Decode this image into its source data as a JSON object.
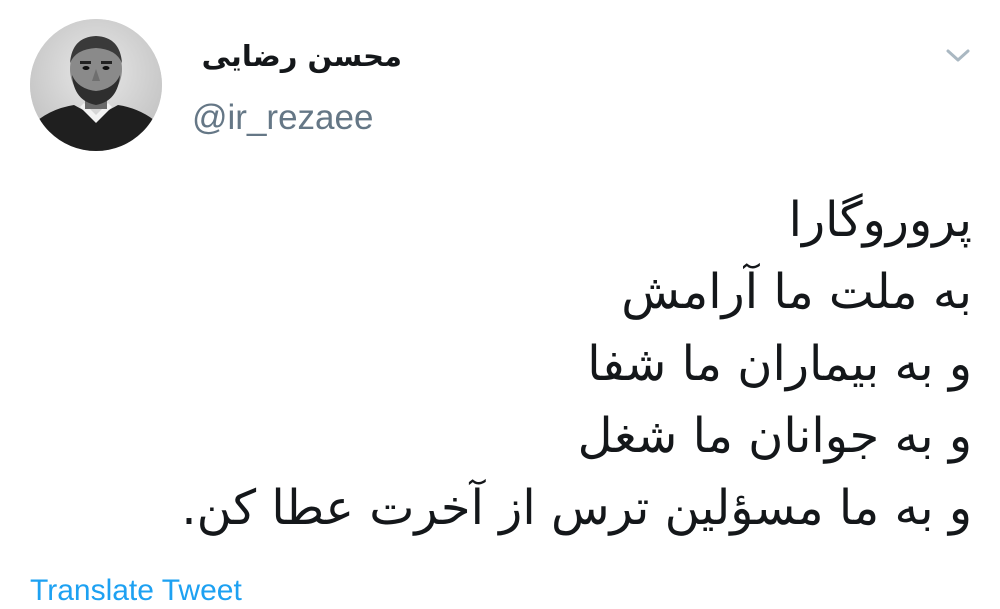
{
  "tweet": {
    "author": {
      "display_name": "محسن رضایی",
      "handle": "@ir_rezaee",
      "avatar_icon": "profile-photo"
    },
    "menu_icon": "chevron-down-icon",
    "text_lines": [
      "پروروگارا",
      "به ملت ما آرامش",
      "و به بیماران ما شفا",
      "و به جوانان ما شغل",
      "و به  ما مسؤلین ترس از آخرت عطا کن."
    ],
    "translate_label": "Translate Tweet"
  },
  "colors": {
    "text_primary": "#14171a",
    "text_secondary": "#657786",
    "link": "#1da1f2",
    "chevron": "#aab8c2"
  }
}
